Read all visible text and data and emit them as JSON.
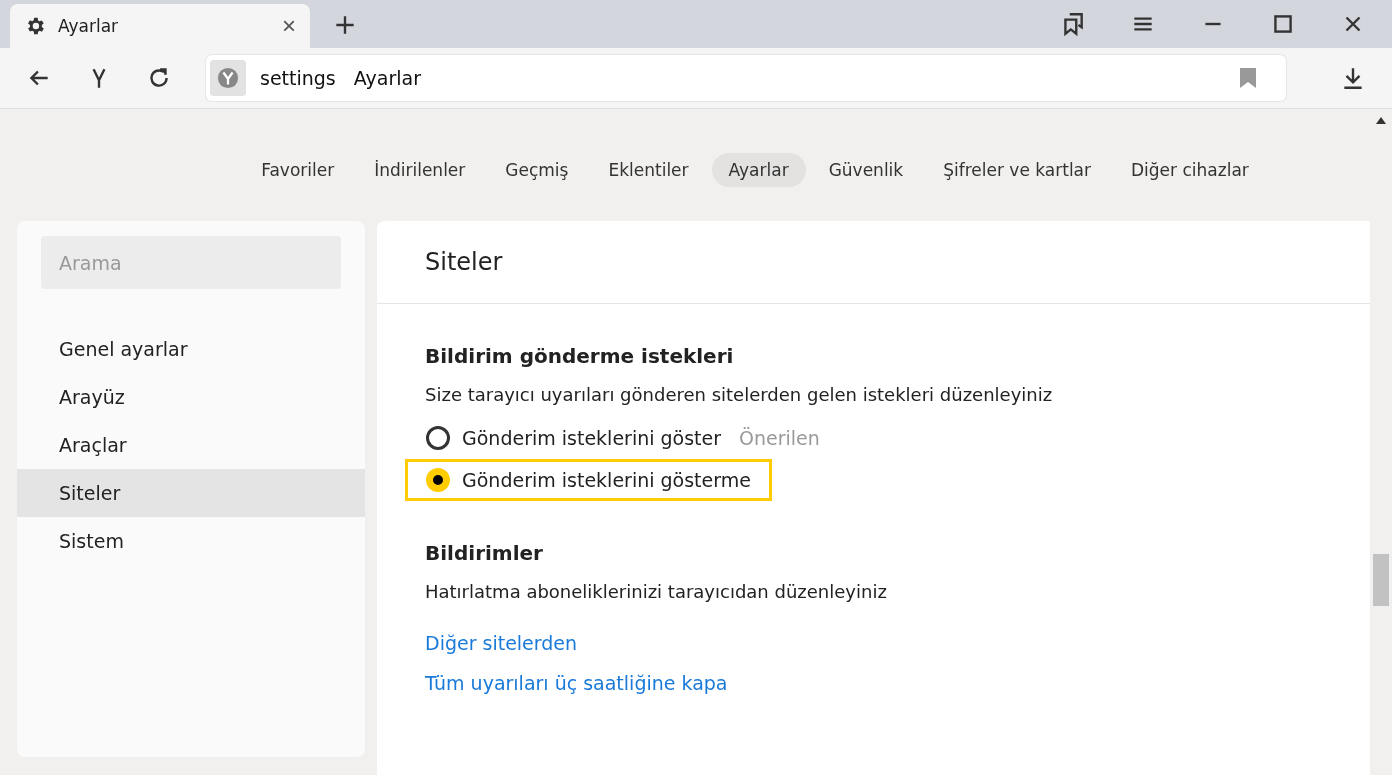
{
  "browser_tab": {
    "title": "Ayarlar",
    "close": "×"
  },
  "address_bar": {
    "scheme": "settings",
    "title": "Ayarlar"
  },
  "nav_tabs": [
    {
      "label": "Favoriler",
      "selected": false
    },
    {
      "label": "İndirilenler",
      "selected": false
    },
    {
      "label": "Geçmiş",
      "selected": false
    },
    {
      "label": "Eklentiler",
      "selected": false
    },
    {
      "label": "Ayarlar",
      "selected": true
    },
    {
      "label": "Güvenlik",
      "selected": false
    },
    {
      "label": "Şifreler ve kartlar",
      "selected": false
    },
    {
      "label": "Diğer cihazlar",
      "selected": false
    }
  ],
  "sidebar": {
    "search": {
      "placeholder": "Arama"
    },
    "items": [
      {
        "label": "Genel ayarlar",
        "selected": false
      },
      {
        "label": "Arayüz",
        "selected": false
      },
      {
        "label": "Araçlar",
        "selected": false
      },
      {
        "label": "Siteler",
        "selected": true
      },
      {
        "label": "Sistem",
        "selected": false
      }
    ]
  },
  "page_title": "Siteler",
  "sections": [
    {
      "title": "Bildirim gönderme istekleri",
      "description": "Size tarayıcı uyarıları gönderen sitelerden gelen istekleri düzenleyiniz",
      "options": [
        {
          "label": "Gönderim isteklerini göster",
          "note": "Önerilen",
          "selected": false,
          "highlighted": false
        },
        {
          "label": "Gönderim isteklerini gösterme",
          "selected": true,
          "highlighted": true
        }
      ]
    },
    {
      "title": "Bildirimler",
      "description": "Hatırlatma aboneliklerinizi tarayıcıdan düzenleyiniz",
      "links": [
        "Diğer sitelerden",
        "Tüm uyarıları üç saatliğine kapa"
      ]
    }
  ]
}
